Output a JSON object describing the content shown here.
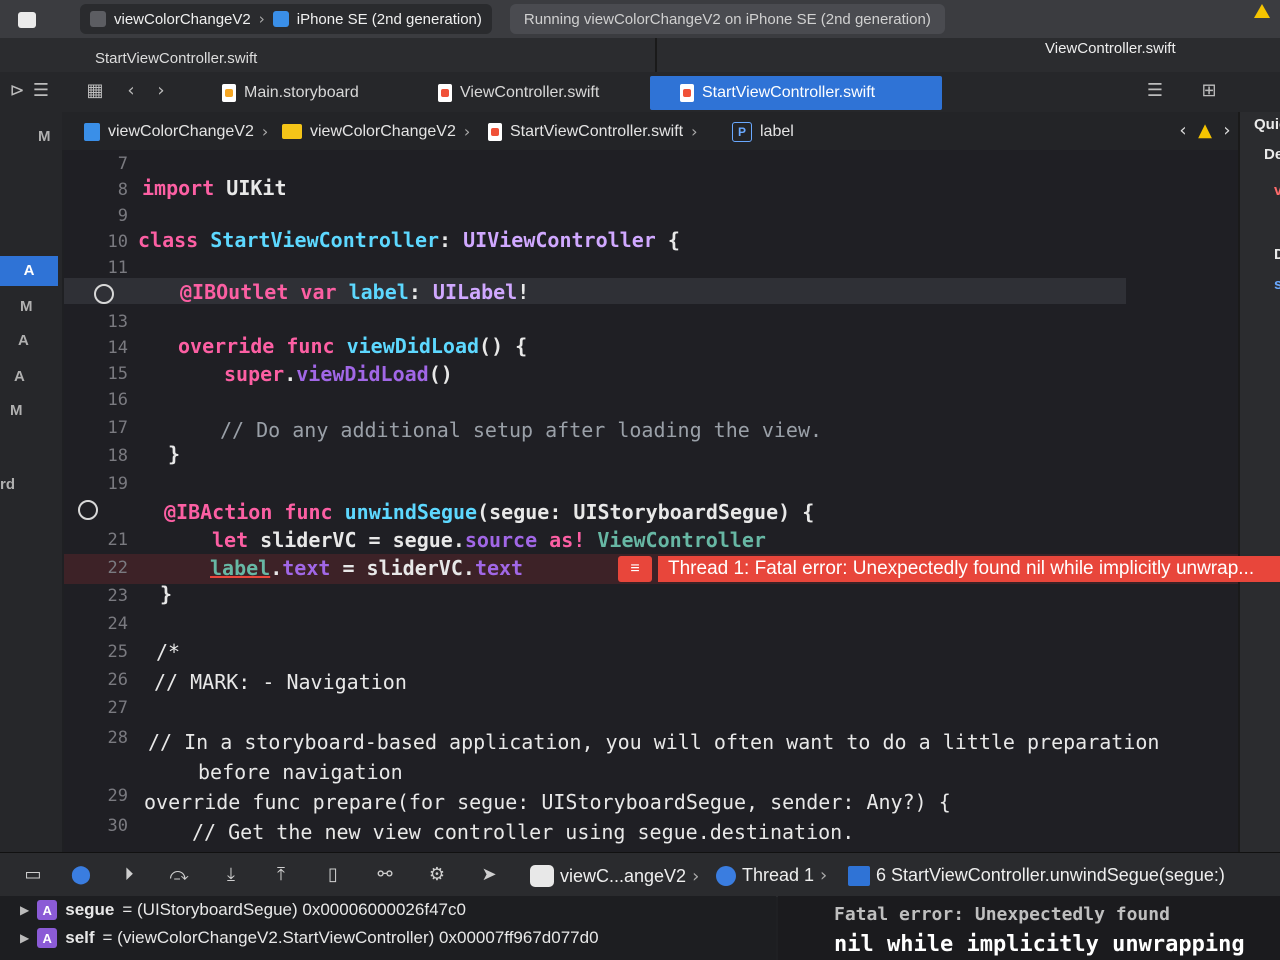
{
  "window": {
    "scheme_project": "viewColorChangeV2",
    "scheme_device": "iPhone SE (2nd generation)",
    "status_text": "Running viewColorChangeV2 on iPhone SE (2nd generation)"
  },
  "editor_titles": {
    "left": "StartViewController.swift",
    "right": "ViewController.swift"
  },
  "tabs": [
    {
      "label": "Main.storyboard",
      "icon": "storyboard-file-icon"
    },
    {
      "label": "ViewController.swift",
      "icon": "swift-file-icon"
    },
    {
      "label": "StartViewController.swift",
      "icon": "swift-file-icon",
      "active": true
    }
  ],
  "breadcrumb": {
    "project": "viewColorChangeV2",
    "folder": "viewColorChangeV2",
    "file": "StartViewController.swift",
    "symbol_badge": "P",
    "symbol": "label"
  },
  "left_nav_marks": [
    "M",
    "A",
    "M",
    "A",
    "A",
    "M",
    "rd"
  ],
  "inspector_labels": [
    "Quic",
    "De",
    "v",
    "D",
    "s"
  ],
  "line_numbers": [
    "7",
    "8",
    "9",
    "10",
    "11",
    "",
    "13",
    "14",
    "15",
    "16",
    "17",
    "18",
    "19",
    "",
    "21",
    "22",
    "23",
    "24",
    "25",
    "26",
    "27",
    "28",
    "29",
    "30"
  ],
  "code": {
    "l8": [
      "import",
      "UIKit"
    ],
    "l10": [
      "class",
      "StartViewController",
      ":",
      "UIViewController",
      "{"
    ],
    "l12": [
      "@IBOutlet",
      "var",
      "label",
      ":",
      "UILabel",
      "!"
    ],
    "l14": [
      "override",
      "func",
      "viewDidLoad",
      "() {"
    ],
    "l15": [
      "super",
      ".",
      "viewDidLoad",
      "()"
    ],
    "l17": "// Do any additional setup after loading the view.",
    "l18": "}",
    "l20": [
      "@IBAction",
      "func",
      "unwindSegue",
      "(segue: ",
      "UIStoryboardSegue",
      ") {"
    ],
    "l21": [
      "let",
      "sliderVC = segue.",
      "source",
      "as",
      "! ",
      "ViewController"
    ],
    "l22": [
      "label",
      ".",
      "text",
      " = sliderVC.",
      "text"
    ],
    "l23": "}",
    "l25": "/*",
    "l26": "// MARK: - Navigation",
    "l28a": "// In a storyboard-based application, you will often want to do a little preparation",
    "l28b": "before navigation",
    "l29": "override func prepare(for segue: UIStoryboardSegue, sender: Any?) {",
    "l30": "// Get the new view controller using segue.destination."
  },
  "error": {
    "badge": "≡",
    "message": "Thread 1: Fatal error: Unexpectedly found nil while implicitly unwrap..."
  },
  "debug_bar": {
    "app": "viewC...angeV2",
    "thread": "Thread 1",
    "frame": "6 StartViewController.unwindSegue(segue:)"
  },
  "variables": [
    {
      "badge": "A",
      "name": "segue",
      "value": "= (UIStoryboardSegue) 0x00006000026f47c0"
    },
    {
      "badge": "A",
      "name": "self",
      "value": "= (viewColorChangeV2.StartViewController) 0x00007ff967d077d0"
    }
  ],
  "console": {
    "line1": "Fatal error: Unexpectedly found",
    "line2": "nil while implicitly unwrapping"
  },
  "colors": {
    "keyword": "#fc5fa3",
    "type": "#5dd8ff",
    "error": "#e8463b",
    "selection": "#2f73d6"
  }
}
